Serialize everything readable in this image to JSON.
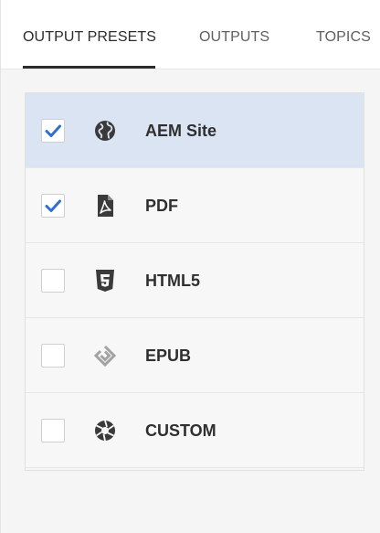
{
  "tabs": [
    {
      "label": "OUTPUT PRESETS",
      "active": true
    },
    {
      "label": "OUTPUTS",
      "active": false
    },
    {
      "label": "TOPICS",
      "active": false
    }
  ],
  "presets": [
    {
      "label": "AEM Site",
      "checked": true,
      "selected": true,
      "icon": "globe-icon"
    },
    {
      "label": "PDF",
      "checked": true,
      "selected": false,
      "icon": "pdf-icon"
    },
    {
      "label": "HTML5",
      "checked": false,
      "selected": false,
      "icon": "html5-icon"
    },
    {
      "label": "EPUB",
      "checked": false,
      "selected": false,
      "icon": "epub-icon"
    },
    {
      "label": "CUSTOM",
      "checked": false,
      "selected": false,
      "icon": "aperture-icon"
    }
  ],
  "colors": {
    "accent": "#2f6fcf",
    "selected_row": "#dbe4f2",
    "icon": "#3a3a3a"
  }
}
